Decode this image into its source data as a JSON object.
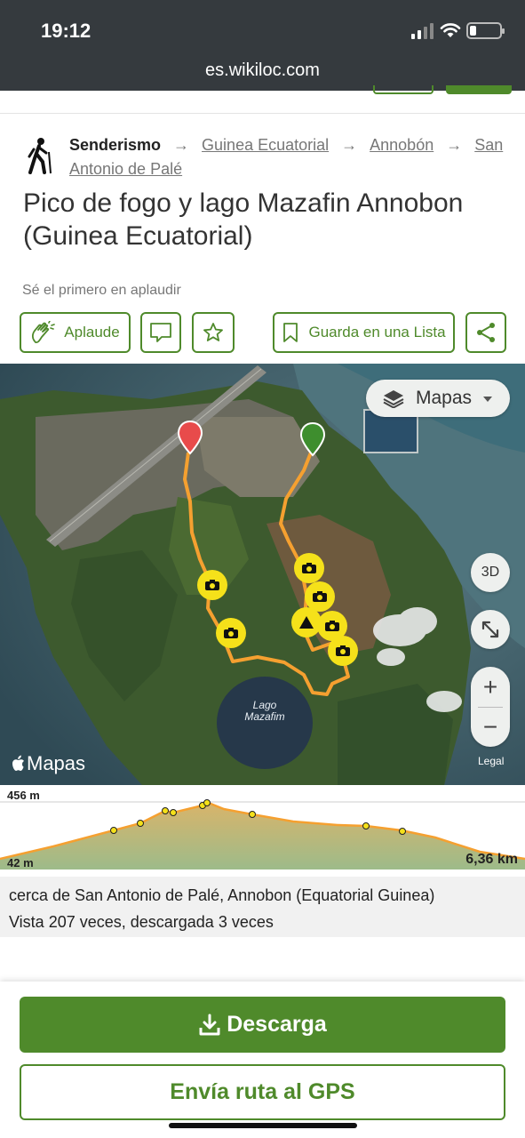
{
  "status_bar": {
    "time": "19:12",
    "battery_level": 0.15
  },
  "url_bar": {
    "url": "es.wikiloc.com"
  },
  "breadcrumb": {
    "category": "Senderismo",
    "links": [
      "Guinea Ecuatorial",
      "Annobón",
      "San Antonio de Palé"
    ]
  },
  "trail": {
    "title": "Pico de fogo y lago Mazafin Annobon (Guinea Ecuatorial)"
  },
  "applause_note": "Sé el primero en aplaudir",
  "actions": {
    "applaud": "Aplaude",
    "save_list": "Guarda en una Lista"
  },
  "map": {
    "layers_label": "Mapas",
    "btn_3d": "3D",
    "zoom_in": "+",
    "zoom_out": "−",
    "legal": "Legal",
    "attribution": "Mapas",
    "lake_label": "Lago Mazafim",
    "colors": {
      "route": "#f5a030",
      "start_pin": "#e84b4b",
      "end_pin": "#3e8e2e",
      "waypoint": "#f5e11a"
    }
  },
  "elevation_profile": {
    "max_label": "456 m",
    "min_label": "42 m",
    "distance_label": "6,36 km"
  },
  "info": {
    "location": "cerca de San Antonio de Palé, Annobon (Equatorial Guinea)",
    "views": "Vista 207 veces, descargada 3 veces"
  },
  "bottom_actions": {
    "download": "Descarga",
    "send_gps": "Envía ruta al GPS"
  },
  "theme": {
    "brand_green": "#4f8a2b",
    "statusbar_bg": "#353a3e"
  }
}
